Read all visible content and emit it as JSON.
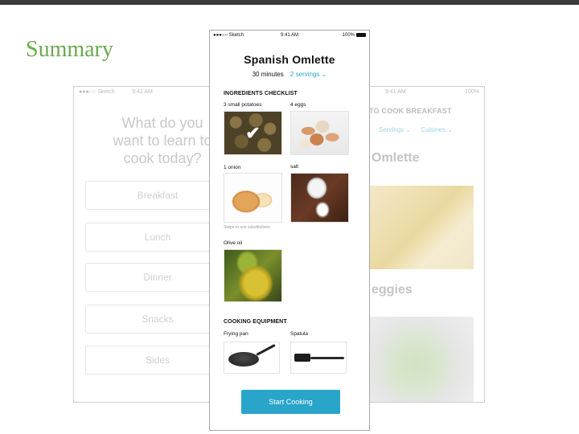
{
  "slide": {
    "title": "Summary"
  },
  "left_phone": {
    "status": {
      "carrier": "●●●○○ Sketch",
      "time": "9:41 AM"
    },
    "question": "What do you want to learn to cook today?",
    "meals": [
      "Breakfast",
      "Lunch",
      "Dinner",
      "Snacks",
      "Sides"
    ]
  },
  "right_phone": {
    "status": {
      "time": "9:41 AM",
      "battery": "100%"
    },
    "title": "TO COOK BREAKFAST",
    "filters": [
      "Servings ⌄",
      "Cuisines ⌄"
    ],
    "item1": "Omlette",
    "item2": "eggies"
  },
  "main_phone": {
    "status": {
      "carrier": "●●●○○ Sketch",
      "time": "9:41 AM",
      "battery": "100%"
    },
    "recipe_title": "Spanish Omlette",
    "time": "30 minutes",
    "servings": "2 servings ⌄",
    "ingredients_title": "INGREDIENTS CHECKLIST",
    "ingredients": [
      {
        "label": "3 small potatoes",
        "icon": "potatoes-image",
        "checked": true
      },
      {
        "label": "4 eggs",
        "icon": "eggs-image",
        "checked": false
      },
      {
        "label": "1 onion",
        "icon": "onion-image",
        "checked": false
      },
      {
        "label": "salt",
        "icon": "salt-image",
        "checked": false
      },
      {
        "label": "Olive oil",
        "icon": "olive-oil-image",
        "checked": false
      }
    ],
    "swipe_hint": "Swipe to see substitutions",
    "equipment_title": "COOKING EQUIPMENT",
    "equipment": [
      {
        "label": "Frying pan",
        "icon": "frying-pan-image"
      },
      {
        "label": "Spatula",
        "icon": "spatula-image"
      }
    ],
    "start_button": "Start Cooking",
    "accent_color": "#28a5c9"
  }
}
